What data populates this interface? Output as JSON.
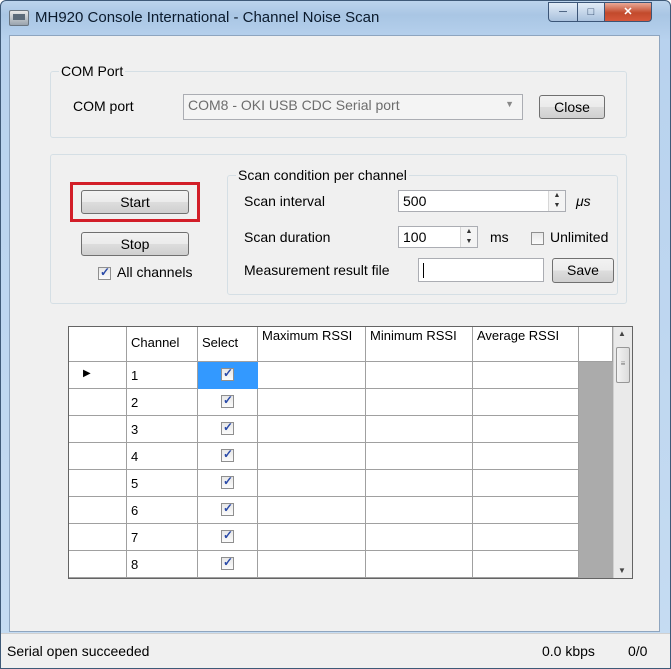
{
  "window": {
    "title": "MH920 Console International - Channel Noise Scan"
  },
  "com_port": {
    "group_title": "COM Port",
    "label": "COM port",
    "selected": "COM8 - OKI USB CDC Serial port",
    "close_label": "Close"
  },
  "controls": {
    "start_label": "Start",
    "stop_label": "Stop",
    "all_channels_label": "All channels"
  },
  "scan": {
    "group_title": "Scan condition per channel",
    "interval_label": "Scan interval",
    "interval_value": "500",
    "interval_unit": "μs",
    "duration_label": "Scan duration",
    "duration_value": "100",
    "duration_unit": "ms",
    "unlimited_label": "Unlimited",
    "file_label": "Measurement result file",
    "file_value": "",
    "save_label": "Save"
  },
  "grid": {
    "columns": [
      "Channel",
      "Select",
      "Maximum RSSI",
      "Minimum RSSI",
      "Average RSSI"
    ],
    "rows": [
      {
        "channel": "1",
        "selected": true
      },
      {
        "channel": "2",
        "selected": true
      },
      {
        "channel": "3",
        "selected": true
      },
      {
        "channel": "4",
        "selected": true
      },
      {
        "channel": "5",
        "selected": true
      },
      {
        "channel": "6",
        "selected": true
      },
      {
        "channel": "7",
        "selected": true
      },
      {
        "channel": "8",
        "selected": true
      }
    ]
  },
  "status": {
    "message": "Serial open succeeded",
    "rate": "0.0 kbps",
    "count": "0/0"
  }
}
